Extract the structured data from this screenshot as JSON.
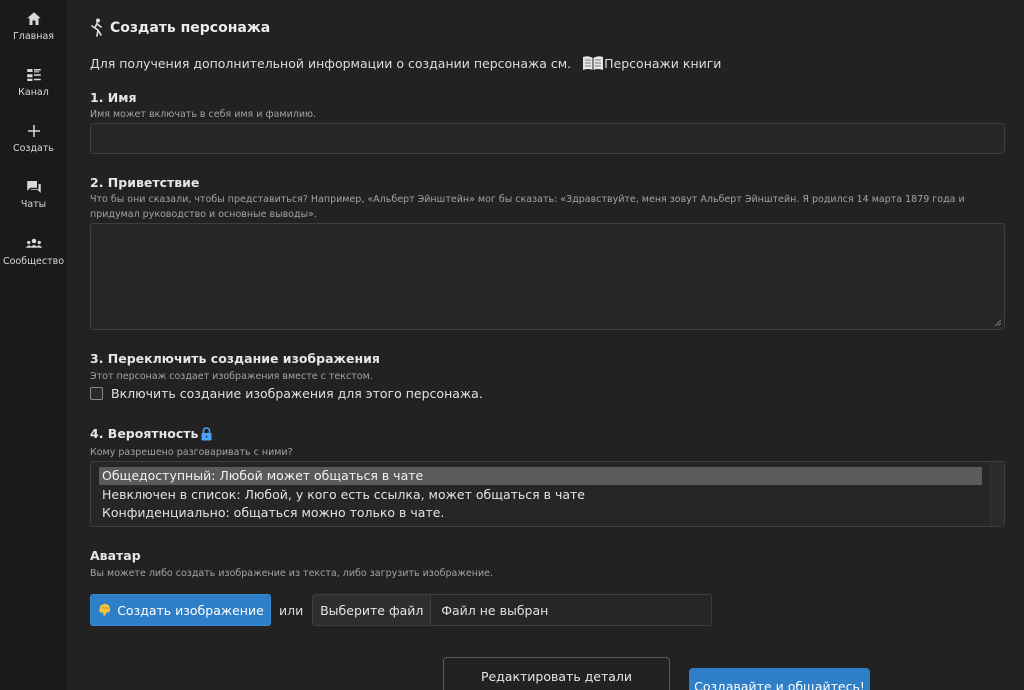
{
  "sidebar": {
    "items": [
      {
        "label": "Главная",
        "icon": "home-icon"
      },
      {
        "label": "Канал",
        "icon": "feed-icon"
      },
      {
        "label": "Создать",
        "icon": "plus-icon"
      },
      {
        "label": "Чаты",
        "icon": "chat-icon"
      },
      {
        "label": "Сообщество",
        "icon": "community-icon"
      }
    ]
  },
  "page": {
    "title": "Создать персонажа",
    "title_icon": "character-icon",
    "info_text": "Для получения дополнительной информации о создании персонажа см.",
    "info_link": "Персонажи книги",
    "info_link_icon": "book-icon"
  },
  "sections": {
    "name": {
      "title": "1. Имя",
      "help": "Имя может включать в себя имя и фамилию.",
      "value": ""
    },
    "greeting": {
      "title": "2. Приветствие",
      "help": "Что бы они сказали, чтобы представиться? Например, «Альберт Эйнштейн» мог бы сказать: «Здравствуйте, меня зовут Альберт Эйнштейн. Я родился 14 марта 1879 года и придумал руководство и основные выводы».",
      "value": ""
    },
    "image_gen": {
      "title": "3. Переключить создание изображения",
      "help": "Этот персонаж создает изображения вместе с текстом.",
      "checkbox_label": "Включить создание изображения для этого персонажа.",
      "checked": false
    },
    "visibility": {
      "title": "4. Вероятность",
      "title_icon": "lock-icon",
      "help": "Кому разрешено разговаривать с ними?",
      "options": [
        "Общедоступный: Любой может общаться в чате",
        "Невключен в список: Любой, у кого есть ссылка, может общаться в чате",
        "Конфиденциально: общаться можно только в чате."
      ],
      "selected_index": 0
    },
    "avatar": {
      "title": "Аватар",
      "help": "Вы можете либо создать изображение из текста, либо загрузить изображение.",
      "create_button": "Создать изображение",
      "create_icon": "brain-icon",
      "or_text": "или",
      "file_button": "Выберите файл",
      "file_status": "Файл не выбран"
    }
  },
  "footer": {
    "edit_details": "Редактировать детали",
    "submit": "Создавайте и общайтесь!"
  },
  "colors": {
    "background": "#222222",
    "sidebar": "#1a1a1a",
    "accent": "#2f7fc8",
    "lock": "#4aa3ff"
  }
}
